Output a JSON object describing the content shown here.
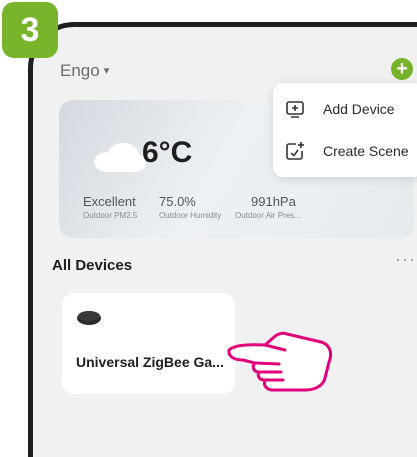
{
  "step_badge": "3",
  "header": {
    "home_name": "Engo",
    "caret": "▾",
    "add_button_icon": "+"
  },
  "weather": {
    "icon": "cloud-icon",
    "temperature": "6°C",
    "metrics": [
      {
        "value": "Excellent",
        "label": "Outdoor PM2.5"
      },
      {
        "value": "75.0%",
        "label": "Outdoor Humidity"
      },
      {
        "value": "991hPa",
        "label": "Outdoor Air Pres..."
      }
    ]
  },
  "popup_menu": {
    "items": [
      {
        "icon": "add-device-icon",
        "label": "Add Device"
      },
      {
        "icon": "create-scene-icon",
        "label": "Create Scene"
      }
    ]
  },
  "devices_section": {
    "title": "All Devices",
    "more_icon": "···",
    "devices": [
      {
        "icon": "gateway-device-icon",
        "name": "Universal ZigBee Ga..."
      }
    ]
  },
  "colors": {
    "accent_green": "#76b32a",
    "step_badge": "#79b52b",
    "pointer_hand": "#e2007a",
    "phone_frame": "#1f1f1f",
    "background": "#f1f1f1"
  }
}
